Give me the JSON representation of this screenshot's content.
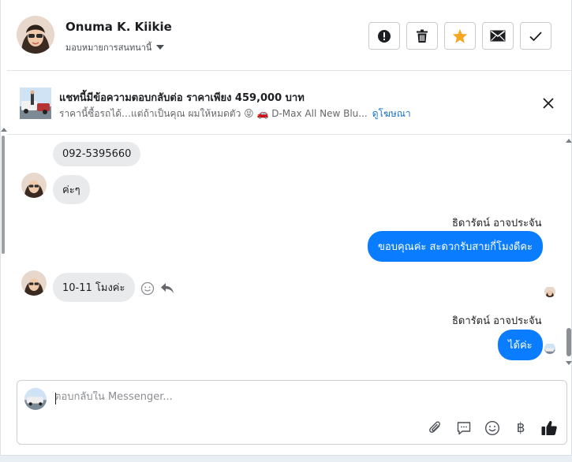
{
  "header": {
    "contact_name": "Onuma K. Kiikie",
    "assign_label": "มอบหมายการสนทนานี้",
    "buttons": [
      {
        "name": "report-button",
        "icon": "alert-icon"
      },
      {
        "name": "delete-button",
        "icon": "trash-icon"
      },
      {
        "name": "star-button",
        "icon": "star-icon",
        "color": "#f5a623"
      },
      {
        "name": "mail-button",
        "icon": "envelope-icon"
      },
      {
        "name": "done-button",
        "icon": "check-icon"
      }
    ]
  },
  "ad": {
    "title": "แชทนี้มีข้อความตอบกลับต่อ ราคาเพียง 459,000 บาท",
    "description": "ราคานี้ซื้อรถได้…แต่ถ้าเป็นคุณ ผมให้หมดตัว 😝 🚗 D-Max All New Blu...",
    "link_label": "ดูโฆษณา"
  },
  "messages": [
    {
      "dir": "in",
      "text": "092-5395660"
    },
    {
      "dir": "in",
      "text": "ค่ะๆ"
    },
    {
      "dir": "out",
      "sender": "ธิดารัตน์ อาจประจัน",
      "text": "ขอบคุณค่ะ สะดวกรับสายกี่โมงดีคะ"
    },
    {
      "dir": "in",
      "text": "10-11 โมงค่ะ"
    },
    {
      "dir": "out",
      "sender": "ธิดารัตน์ อาจประจัน",
      "text": "ได้ค่ะ"
    }
  ],
  "composer": {
    "placeholder": "ตอบกลับใน Messenger...",
    "tools": [
      "paperclip-icon",
      "saved-reply-icon",
      "emoji-icon",
      "baht-icon",
      "thumbs-up-icon"
    ],
    "baht_symbol": "฿"
  },
  "colors": {
    "accent": "#0a7cff",
    "incoming_bubble": "#e9eaec",
    "link": "#1a73c8"
  }
}
